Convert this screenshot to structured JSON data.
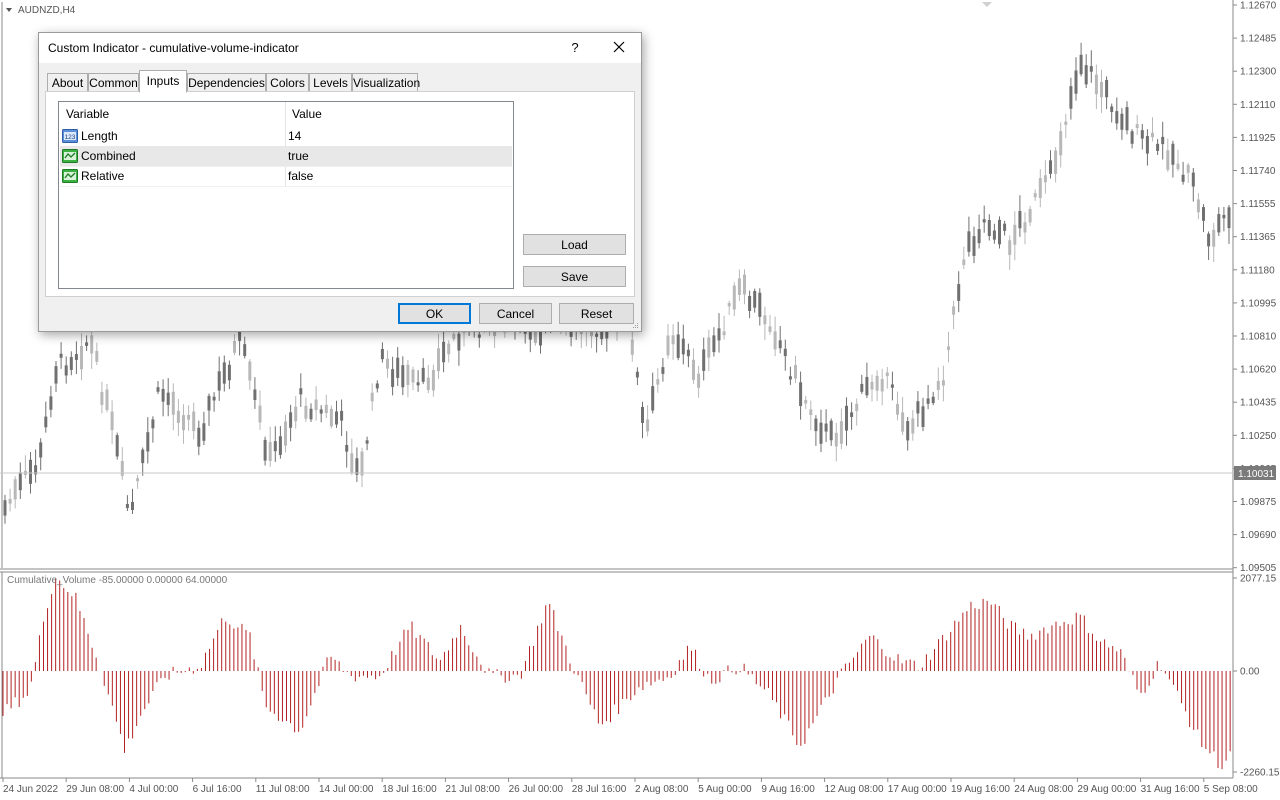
{
  "symbol_label": "AUDNZD,H4",
  "indicator_label": "Cumulative_Volume -85.00000 0.00000 64.00000",
  "current_price": "1.10031",
  "price_levels": [
    "1.12670",
    "1.12485",
    "1.12300",
    "1.12110",
    "1.11925",
    "1.11740",
    "1.11555",
    "1.11365",
    "1.11180",
    "1.10995",
    "1.10810",
    "1.10620",
    "1.10435",
    "1.10250",
    "1.10065",
    "1.09875",
    "1.09690",
    "1.09505"
  ],
  "indicator_levels": [
    "2077.15",
    "0.00",
    "-2260.15"
  ],
  "time_labels": [
    "24 Jun 2022",
    "29 Jun 08:00",
    "4 Jul 00:00",
    "6 Jul 16:00",
    "11 Jul 08:00",
    "14 Jul 00:00",
    "18 Jul 16:00",
    "21 Jul 08:00",
    "26 Jul 00:00",
    "28 Jul 16:00",
    "2 Aug 08:00",
    "5 Aug 00:00",
    "9 Aug 16:00",
    "12 Aug 08:00",
    "17 Aug 00:00",
    "19 Aug 16:00",
    "24 Aug 08:00",
    "29 Aug 00:00",
    "31 Aug 16:00",
    "5 Sep 08:00"
  ],
  "colors": {
    "bull_candle": "#b8b8b8",
    "bear_candle": "#707070",
    "volume_bar": "#b22222",
    "price_tag_bg": "#7a7a7a"
  },
  "dialog": {
    "title": "Custom Indicator - cumulative-volume-indicator",
    "help_label": "?",
    "tabs": [
      "About",
      "Common",
      "Inputs",
      "Dependencies",
      "Colors",
      "Levels",
      "Visualization"
    ],
    "active_tab": "Inputs",
    "columns": {
      "variable": "Variable",
      "value": "Value"
    },
    "rows": [
      {
        "name": "Length",
        "value": "14",
        "icon": "numeric-123-icon"
      },
      {
        "name": "Combined",
        "value": "true",
        "icon": "boolean-chart-icon"
      },
      {
        "name": "Relative",
        "value": "false",
        "icon": "boolean-chart-icon"
      }
    ],
    "load_label": "Load",
    "save_label": "Save",
    "ok_label": "OK",
    "cancel_label": "Cancel",
    "reset_label": "Reset"
  }
}
